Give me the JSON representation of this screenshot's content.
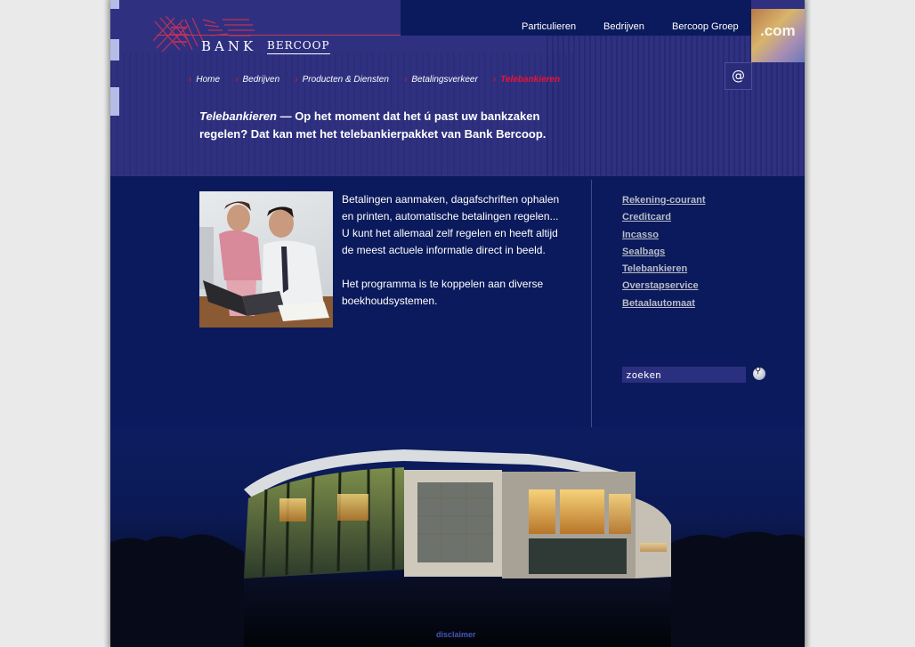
{
  "brand": {
    "name_bank": "BANK",
    "name_bercoop": "BERCOOP"
  },
  "topnav": {
    "items": [
      "Particulieren",
      "Bedrijven",
      "Bercoop Groep"
    ]
  },
  "header_image_text": ".com",
  "breadcrumb": {
    "items": [
      "Home",
      "Bedrijven",
      "Producten & Diensten",
      "Betalingsverkeer"
    ],
    "current": "Telebankieren"
  },
  "at_button": "@",
  "intro": {
    "title": "Telebankieren",
    "dash": " — ",
    "text": "Op het moment dat het ú past uw bankzaken regelen? Dat kan met het telebankierpakket van Bank Bercoop."
  },
  "main": {
    "paragraph1": "Betalingen aanmaken, dagafschriften ophalen en printen, automatische betalingen regelen... U kunt het allemaal zelf regelen en heeft altijd de meest actuele informatie direct in beeld.",
    "paragraph2": "Het programma is te koppelen aan diverse boekhoudsystemen."
  },
  "sidenav": {
    "items": [
      "Rekening-courant",
      "Creditcard",
      "Incasso",
      "Sealbags",
      "Telebankieren",
      "Overstapservice",
      "Betaalautomaat"
    ]
  },
  "search": {
    "value": "zoeken"
  },
  "footer": {
    "disclaimer": "disclaimer"
  },
  "colors": {
    "page_bg": "#eaeaea",
    "body_bg": "#0b1a5c",
    "header_bg": "#2f3180",
    "accent_red": "#cc1133",
    "link_gray": "#b8bbc6"
  },
  "icons": {
    "search": "magnifier-icon",
    "email": "at-icon",
    "crumb_arrow": "chevron-right-icon"
  }
}
